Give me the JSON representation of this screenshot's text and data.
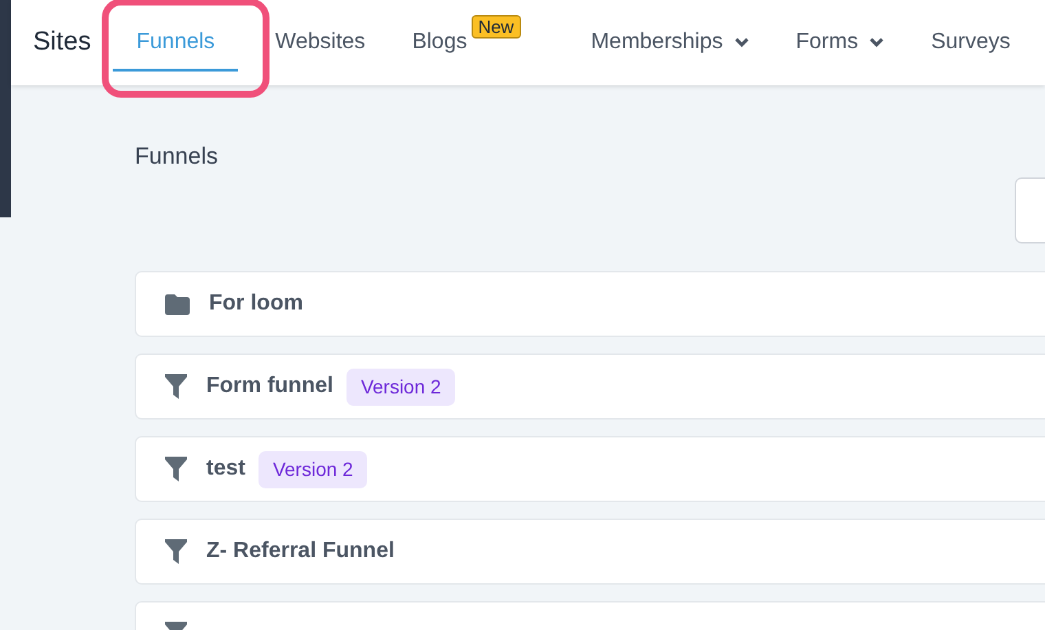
{
  "nav": {
    "brand": "Sites",
    "tabs": [
      {
        "label": "Funnels",
        "selected": true,
        "dropdown": false
      },
      {
        "label": "Websites",
        "selected": false,
        "dropdown": false
      },
      {
        "label": "Blogs",
        "selected": false,
        "dropdown": false,
        "badge": "New"
      },
      {
        "label": "Memberships",
        "selected": false,
        "dropdown": true
      },
      {
        "label": "Forms",
        "selected": false,
        "dropdown": true
      },
      {
        "label": "Surveys",
        "selected": false,
        "dropdown": false
      }
    ]
  },
  "page_title": "Funnels",
  "items": [
    {
      "kind": "folder",
      "name": "For loom"
    },
    {
      "kind": "funnel",
      "name": "Form funnel",
      "badge": "Version 2"
    },
    {
      "kind": "funnel",
      "name": "test",
      "badge": "Version 2"
    },
    {
      "kind": "funnel",
      "name": "Z- Referral Funnel"
    },
    {
      "kind": "funnel"
    }
  ]
}
